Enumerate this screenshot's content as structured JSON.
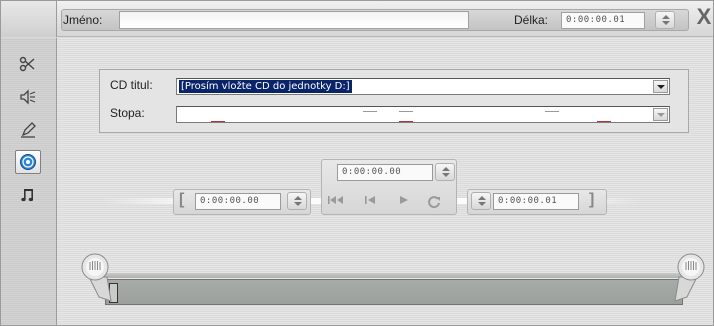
{
  "header": {
    "name_label": "Jméno:",
    "name_value": "",
    "length_label": "Délka:",
    "length_value": "0:00:00.01",
    "close_label": "X"
  },
  "sidebar": {
    "items": [
      {
        "name": "video-tools-icon",
        "glyph": "✂",
        "active": false
      },
      {
        "name": "audio-icon",
        "glyph": "🔈",
        "active": false
      },
      {
        "name": "edit-pen-icon",
        "glyph": "✎",
        "active": false
      },
      {
        "name": "cd-icon",
        "glyph": "◉",
        "active": true
      },
      {
        "name": "music-note-icon",
        "glyph": "♫",
        "active": false
      }
    ]
  },
  "cd": {
    "title_label": "CD titul:",
    "title_value": "[Prosím vložte CD do jednotky D:]",
    "track_label": "Stopa:",
    "track_value": ""
  },
  "transport": {
    "current_time": "0:00:00.00",
    "mark_in": "0:00:00.00",
    "mark_out": "0:00:00.01",
    "open_bracket": "[",
    "close_bracket": "]"
  },
  "slider": {
    "position": 0
  },
  "colors": {
    "selection": "#0a246a",
    "accent_cd": "#1e6fd0"
  }
}
